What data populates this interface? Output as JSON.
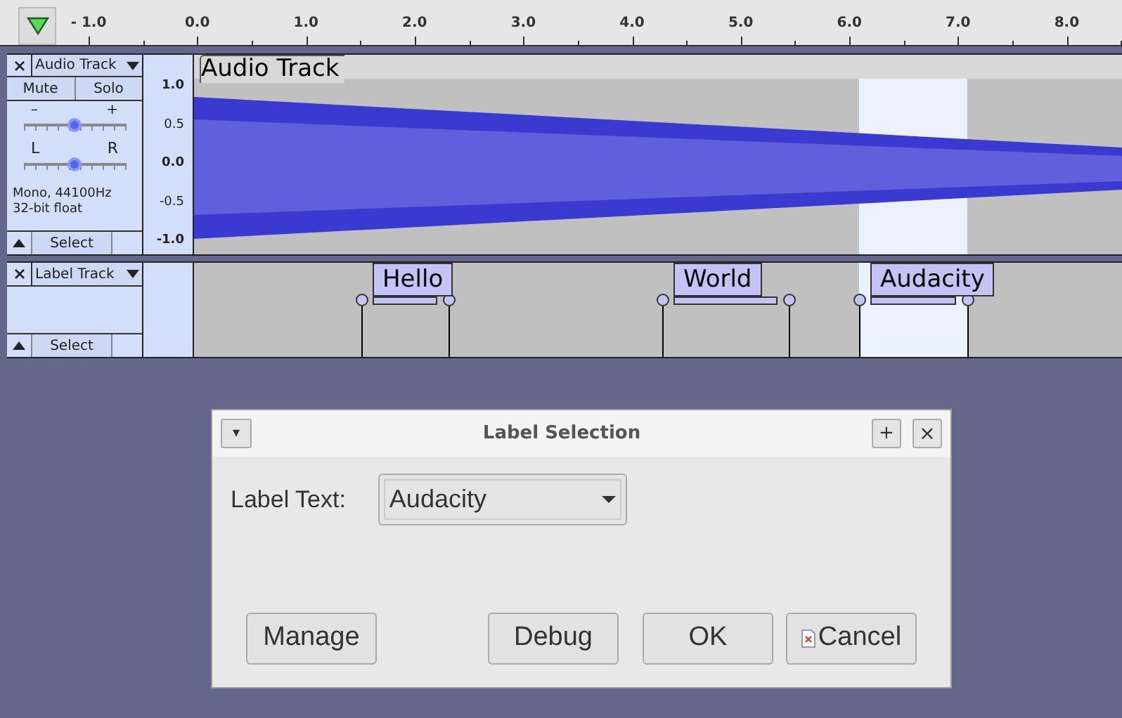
{
  "ruler": {
    "ticks": [
      "- 1.0",
      "0.0",
      "1.0",
      "2.0",
      "3.0",
      "4.0",
      "5.0",
      "6.0",
      "7.0",
      "8.0"
    ]
  },
  "audio_track": {
    "name": "Audio Track",
    "title": "Audio Track",
    "mute": "Mute",
    "solo": "Solo",
    "gain": {
      "minus": "–",
      "plus": "+",
      "level": 0.5
    },
    "pan": {
      "left": "L",
      "right": "R",
      "level": 0.5
    },
    "info": [
      "Mono, 44100Hz",
      "32-bit float"
    ],
    "select": "Select",
    "scale": [
      "1.0",
      "0.5",
      "0.0",
      "-0.5",
      "-1.0"
    ]
  },
  "label_track": {
    "name": "Label Track",
    "select": "Select",
    "labels": [
      {
        "text": "Hello",
        "selected": false
      },
      {
        "text": "World",
        "selected": false
      },
      {
        "text": "Audacity",
        "selected": true
      }
    ]
  },
  "dialog": {
    "title": "Label Selection",
    "menu": "▾",
    "maximize": "+",
    "close": "×",
    "field_label": "Label Text:",
    "value": "Audacity",
    "buttons": [
      {
        "label": "Manage",
        "kind": "plain"
      },
      {
        "label": "Debug",
        "kind": "plain"
      },
      {
        "label": "OK",
        "kind": "plain"
      },
      {
        "label": "Cancel",
        "kind": "icon"
      }
    ]
  }
}
